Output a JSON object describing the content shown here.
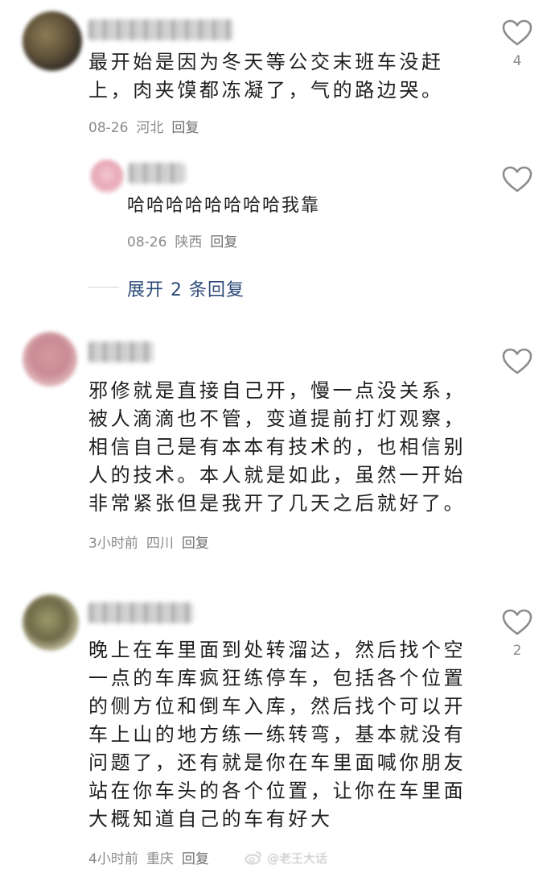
{
  "comments": [
    {
      "text": "最开始是因为冬天等公交末班车没赶\n上，肉夹馍都冻凝了，气的路边哭。",
      "date": "08-26",
      "location": "河北",
      "reply": "回复",
      "likes": "4"
    },
    {
      "text": "哈哈哈哈哈哈哈哈我靠",
      "date": "08-26",
      "location": "陕西",
      "reply": "回复",
      "likes": ""
    },
    {
      "text": "邪修就是直接自己开，慢一点没关系，\n被人滴滴也不管，变道提前打灯观察，\n相信自己是有本本有技术的，也相信别\n人的技术。本人就是如此，虽然一开始\n非常紧张但是我开了几天之后就好了。",
      "date": "3小时前",
      "location": "四川",
      "reply": "回复",
      "likes": ""
    },
    {
      "text": "晚上在车里面到处转溜达，然后找个空\n一点的车库疯狂练停车，包括各个位置\n的侧方位和倒车入库，然后找个可以开\n车上山的地方练一练转弯，基本就没有\n问题了，还有就是你在车里面喊你朋友\n站在你车头的各个位置，让你在车里面\n大概知道自己的车有好大",
      "date": "4小时前",
      "location": "重庆",
      "reply": "回复",
      "likes": "2"
    }
  ],
  "expand_replies": "展开 2 条回复",
  "watermark": "@老王大话",
  "colors": {
    "text": "#1f1f1f",
    "meta": "#8a8a8a",
    "link": "#2c4a78",
    "icon": "#8c8c8c"
  },
  "icons": {
    "like": "heart-outline-icon",
    "watermark": "weibo-logo-icon"
  }
}
